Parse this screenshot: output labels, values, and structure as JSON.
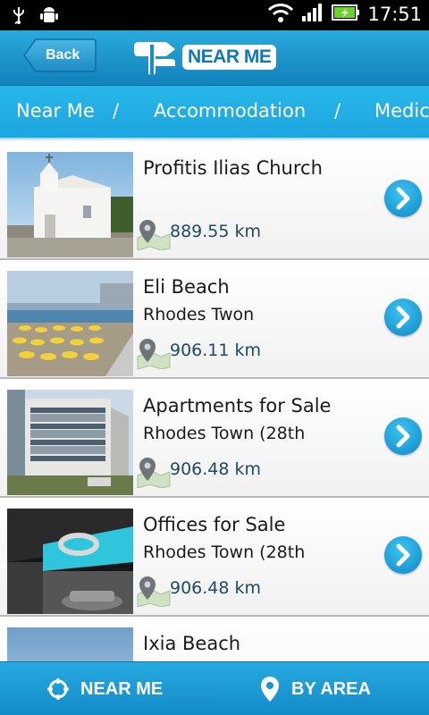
{
  "status_bar": {
    "time": "17:51"
  },
  "header": {
    "back_label": "Back",
    "logo_text": "NEAR ME"
  },
  "breadcrumb": {
    "items": [
      "Near Me",
      "Accommodation",
      "Medic"
    ],
    "separator": "/"
  },
  "list": [
    {
      "title": "Profitis Ilias Church",
      "subtitle": "",
      "distance": "889.55 km"
    },
    {
      "title": "Eli Beach",
      "subtitle": "Rhodes Twon",
      "distance": "906.11 km"
    },
    {
      "title": "Apartments for Sale",
      "subtitle": "Rhodes Town (28th",
      "distance": "906.48 km"
    },
    {
      "title": "Offices for Sale",
      "subtitle": "Rhodes Town (28th",
      "distance": "906.48 km"
    },
    {
      "title": "Ixia Beach",
      "subtitle": "",
      "distance": ""
    }
  ],
  "bottom_tabs": {
    "near_me": "NEAR ME",
    "by_area": "BY AREA"
  },
  "colors": {
    "accent": "#1ca5de",
    "header": "#1282bb",
    "distance": "#1f4a66"
  }
}
